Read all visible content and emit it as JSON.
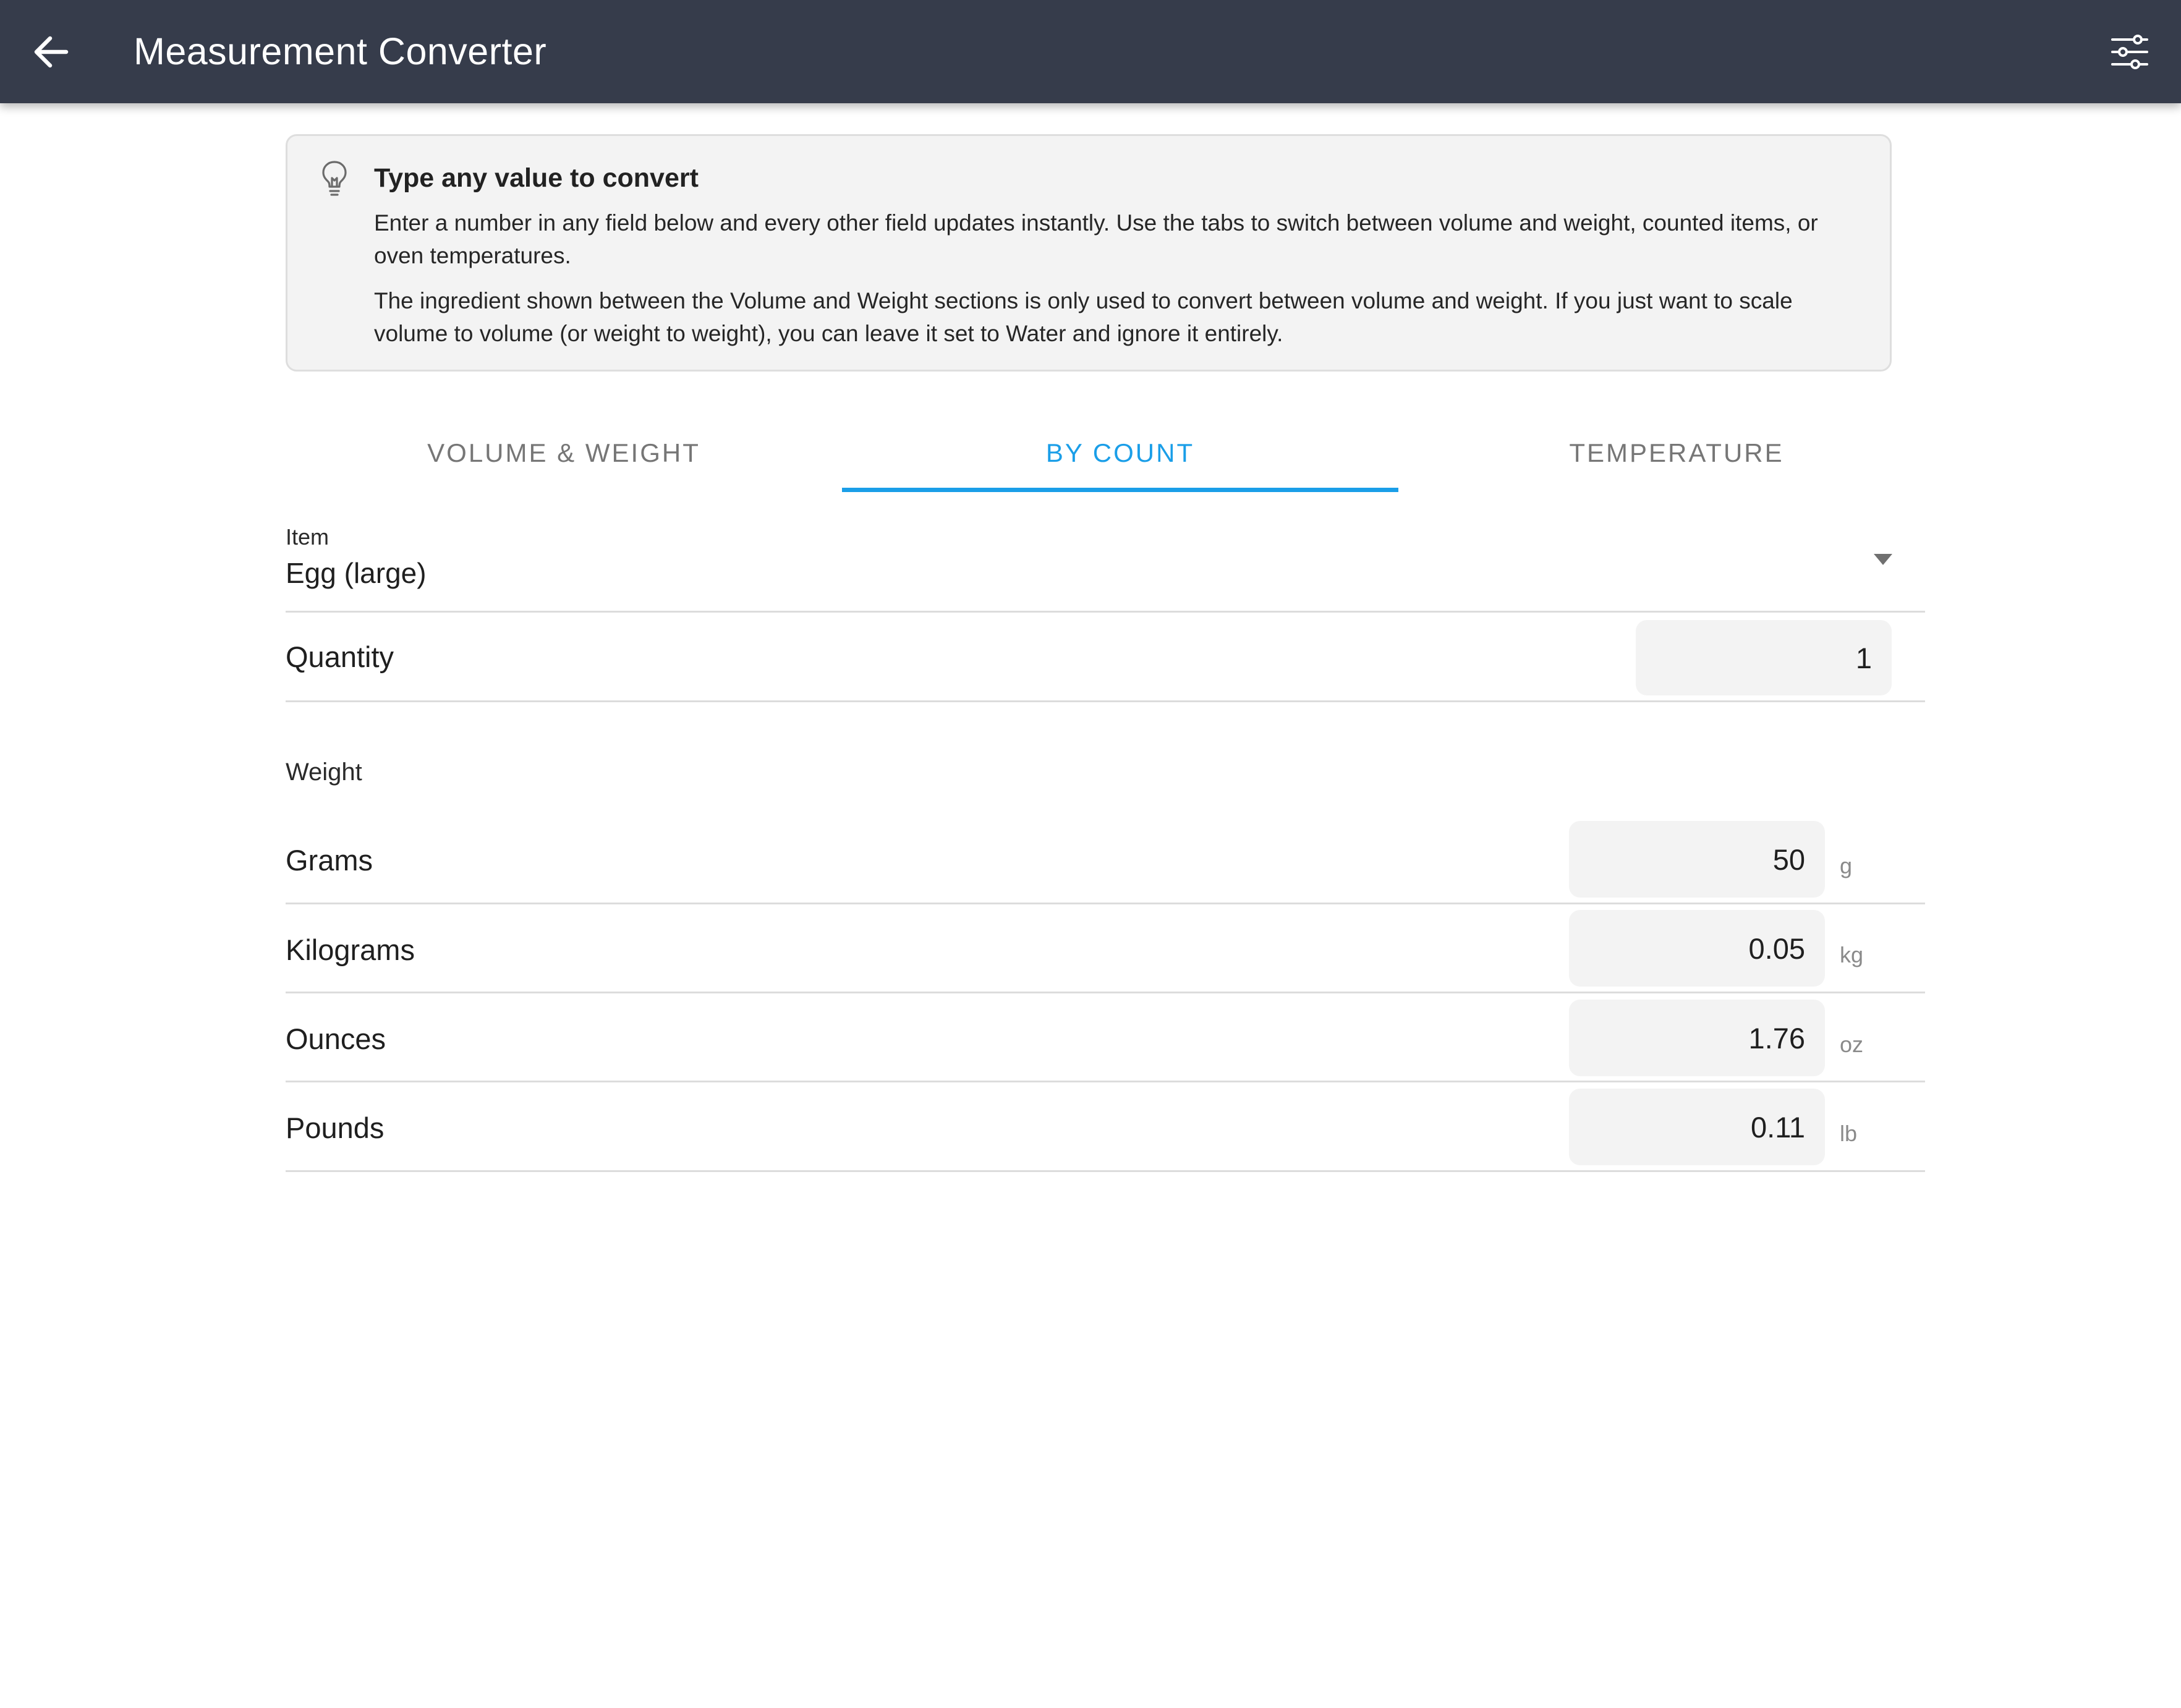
{
  "app_bar": {
    "title": "Measurement Converter",
    "back_icon": "arrow-left-icon",
    "settings_icon": "sliders-icon",
    "background": "#363c4b"
  },
  "hint": {
    "icon": "lightbulb-icon",
    "title": "Type any value to convert",
    "paragraph_1": "Enter a number in any field below and every other field updates instantly. Use the tabs to switch between volume and weight, counted items, or oven temperatures.",
    "paragraph_2": "The ingredient shown between the Volume and Weight sections is only used to convert between volume and weight. If you just want to scale volume to volume (or weight to weight), you can leave it set to Water and ignore it entirely."
  },
  "tabs": [
    {
      "label": "VOLUME & WEIGHT",
      "active": false
    },
    {
      "label": "BY COUNT",
      "active": true
    },
    {
      "label": "TEMPERATURE",
      "active": false
    }
  ],
  "accent_color": "#1a9ee8",
  "item_select": {
    "label": "Item",
    "value": "Egg (large)"
  },
  "quantity": {
    "label": "Quantity",
    "value": "1"
  },
  "weight": {
    "section_label": "Weight",
    "rows": [
      {
        "label": "Grams",
        "value": "50",
        "unit": "g"
      },
      {
        "label": "Kilograms",
        "value": "0.05",
        "unit": "kg"
      },
      {
        "label": "Ounces",
        "value": "1.76",
        "unit": "oz"
      },
      {
        "label": "Pounds",
        "value": "0.11",
        "unit": "lb"
      }
    ]
  }
}
